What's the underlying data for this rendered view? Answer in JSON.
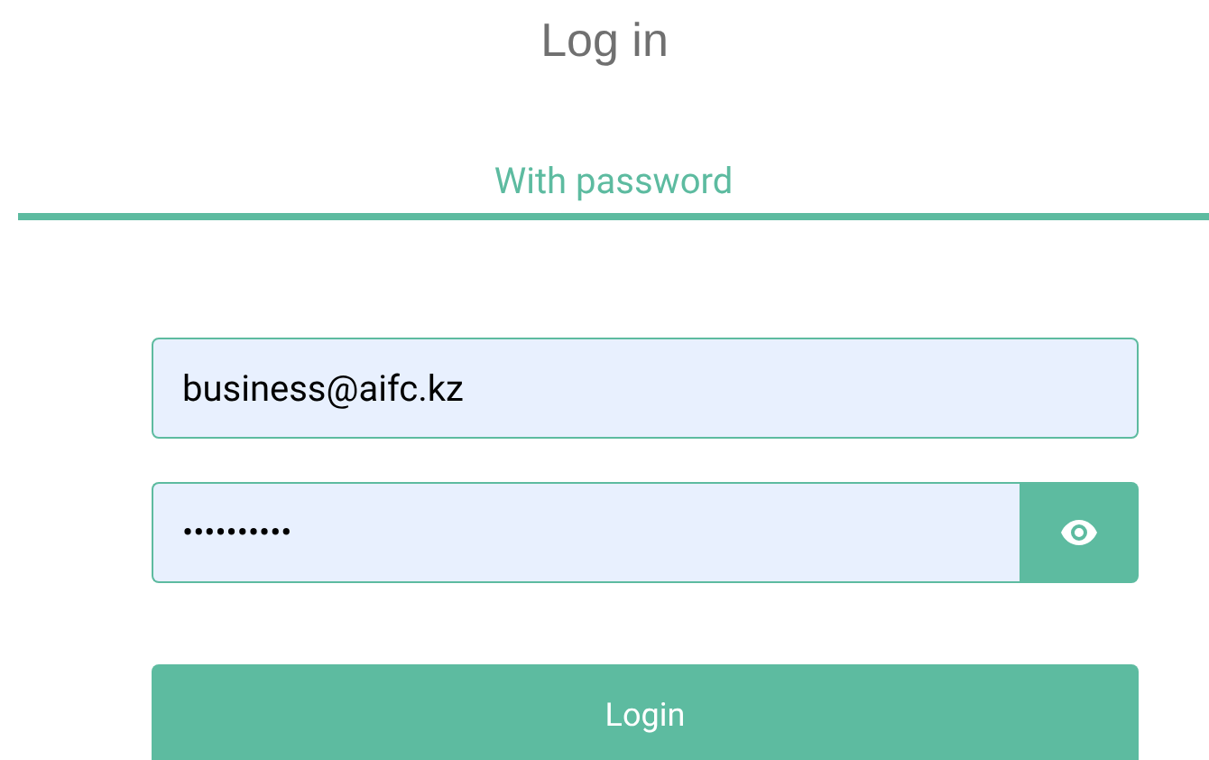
{
  "title": "Log in",
  "tabs": [
    {
      "label": "With password",
      "selected": true
    }
  ],
  "email": {
    "value": "business@aifc.kz"
  },
  "password": {
    "value": "••••••••••"
  },
  "login_button": "Login"
}
